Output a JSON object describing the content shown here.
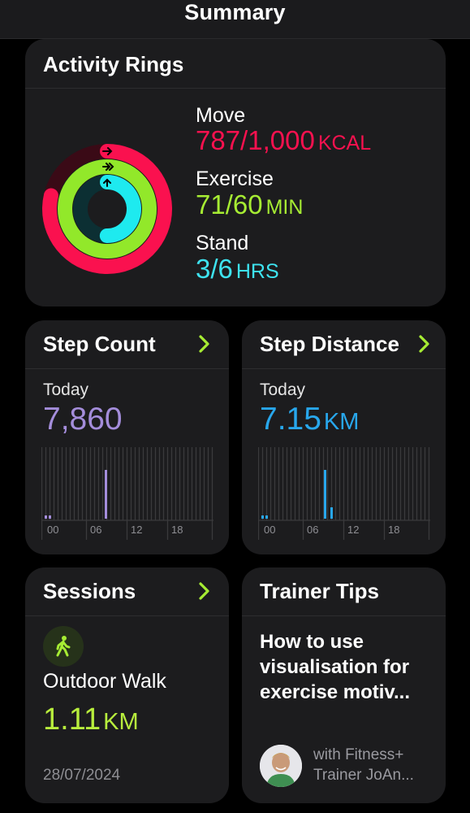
{
  "header": {
    "title": "Summary"
  },
  "activity_rings": {
    "title": "Activity Rings",
    "move": {
      "label": "Move",
      "value": "787/1,000",
      "unit": "KCAL",
      "color": "#fa114f",
      "progress": 0.787
    },
    "exercise": {
      "label": "Exercise",
      "value": "71/60",
      "unit": "MIN",
      "color": "#92e82a",
      "progress": 1.1833
    },
    "stand": {
      "label": "Stand",
      "value": "3/6",
      "unit": "HRS",
      "color": "#1eeaef",
      "progress": 0.5
    }
  },
  "step_count": {
    "title": "Step Count",
    "period": "Today",
    "value": "7,860",
    "color": "#a48ddb",
    "chart": {
      "ticks": [
        "00",
        "06",
        "12",
        "18"
      ]
    }
  },
  "step_distance": {
    "title": "Step Distance",
    "period": "Today",
    "value": "7.15",
    "unit": "KM",
    "color": "#28a7ec",
    "chart": {
      "ticks": [
        "00",
        "06",
        "12",
        "18"
      ]
    }
  },
  "sessions": {
    "title": "Sessions",
    "activity": "Outdoor Walk",
    "value": "1.11",
    "unit": "KM",
    "date": "28/07/2024",
    "icon": "walk-icon"
  },
  "trainer_tips": {
    "title": "Trainer Tips",
    "headline": "How to use visualisation for exercise motiv...",
    "trainer_line1": "with Fitness+",
    "trainer_line2": "Trainer JoAn..."
  }
}
